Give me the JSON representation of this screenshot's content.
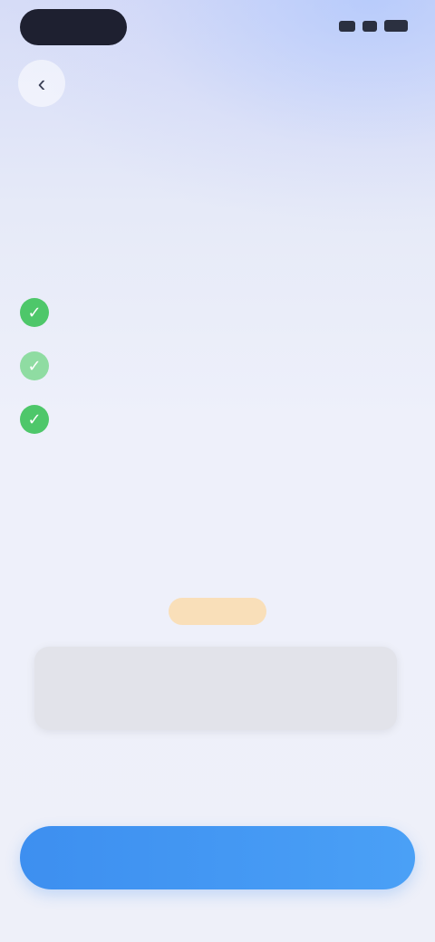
{
  "status_bar": {
    "time": "",
    "icons": [
      "signal-icon",
      "wifi-icon",
      "battery-icon"
    ]
  },
  "nav": {
    "back_icon": "chevron-left-icon",
    "back_glyph": "‹",
    "title": ""
  },
  "header": {
    "title": "",
    "subtitle": ""
  },
  "benefits": [
    {
      "icon": "check-icon",
      "glyph": "✓",
      "label": ""
    },
    {
      "icon": "check-icon",
      "glyph": "✓",
      "label": ""
    },
    {
      "icon": "check-icon",
      "glyph": "✓",
      "label": ""
    }
  ],
  "offer": {
    "text": "",
    "badge": ""
  },
  "plan": {
    "label": ""
  },
  "footer": {
    "fine_print": "",
    "link": "",
    "cta_label": ""
  },
  "colors": {
    "accent": "#3d8ff0",
    "check_green": "#4ec76a",
    "badge": "#ffd696"
  }
}
